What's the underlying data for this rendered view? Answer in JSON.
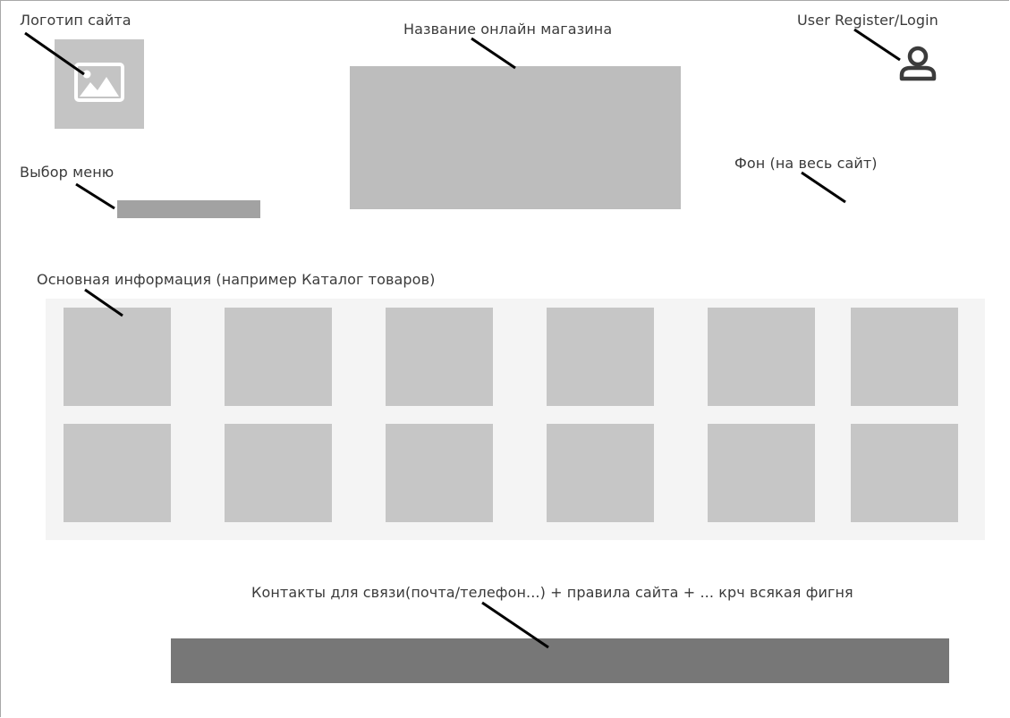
{
  "labels": {
    "logo": "Логотип сайта",
    "store_name": "Название онлайн магазина",
    "user": "User Register/Login",
    "menu": "Выбор меню",
    "background": "Фон (на весь сайт)",
    "main_info": "Основная информация (например Каталог товаров)",
    "footer": "Контакты для связи(почта/телефон...) + правила сайта + ... крч всякая фигня"
  },
  "icons": {
    "logo": "image-placeholder-icon",
    "user": "user-icon"
  },
  "catalog": {
    "rows": 2,
    "columns": 6
  },
  "colors": {
    "placeholder": "#c4c4c4",
    "title_box": "#bdbdbd",
    "menu_bar": "#a2a2a2",
    "catalog_bg": "#f4f4f4",
    "tile": "#c6c6c6",
    "footer": "#777777",
    "pointer": "#000000"
  }
}
